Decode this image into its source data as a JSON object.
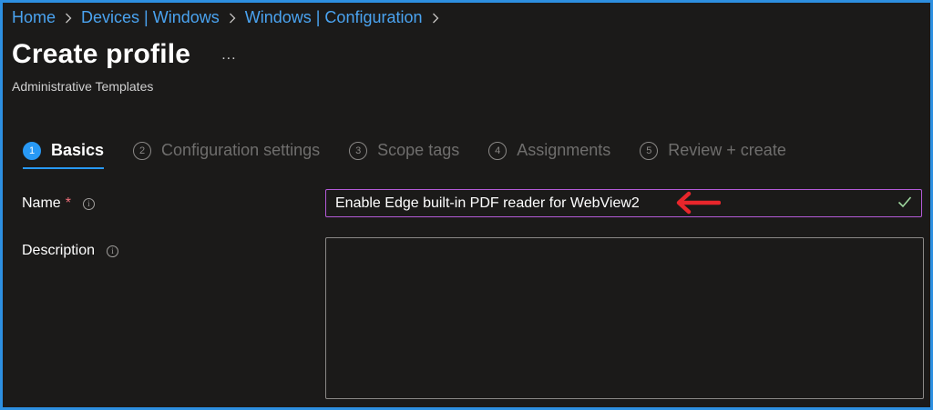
{
  "breadcrumb": {
    "items": [
      "Home",
      "Devices | Windows",
      "Windows | Configuration"
    ]
  },
  "header": {
    "title": "Create profile",
    "more": "...",
    "subtitle": "Administrative Templates"
  },
  "steps": [
    {
      "num": "1",
      "label": "Basics",
      "active": true
    },
    {
      "num": "2",
      "label": "Configuration settings",
      "active": false
    },
    {
      "num": "3",
      "label": "Scope tags",
      "active": false
    },
    {
      "num": "4",
      "label": "Assignments",
      "active": false
    },
    {
      "num": "5",
      "label": "Review + create",
      "active": false
    }
  ],
  "form": {
    "name_label": "Name",
    "required_mark": "*",
    "info_glyph": "i",
    "name_value": "Enable Edge built-in PDF reader for WebView2",
    "description_label": "Description",
    "description_value": ""
  },
  "colors": {
    "accent": "#2899f5",
    "input_border_focus": "#b45ad8",
    "annotation_arrow": "#e8262b",
    "valid_check": "#9fd89f"
  }
}
